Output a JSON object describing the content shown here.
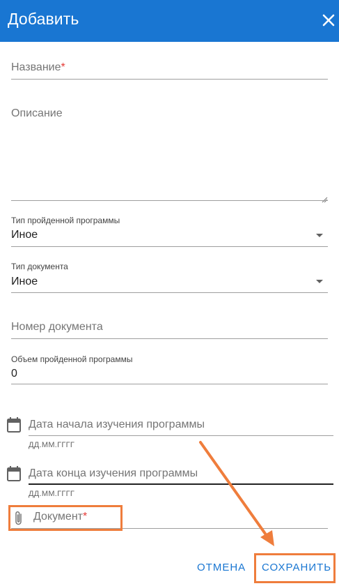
{
  "dialog": {
    "title": "Добавить",
    "close_icon": "close-icon"
  },
  "form": {
    "name_label": "Название",
    "required_mark": "*",
    "description_label": "Описание",
    "program_type": {
      "label": "Тип пройденной программы",
      "value": "Иное"
    },
    "document_type": {
      "label": "Тип документа",
      "value": "Иное"
    },
    "document_number_label": "Номер документа",
    "program_volume": {
      "label": "Объем пройденной программы",
      "value": "0"
    },
    "start_date": {
      "placeholder": "Дата начала изучения программы",
      "hint": "ДД.ММ.ГГГГ",
      "icon": "calendar-icon"
    },
    "end_date": {
      "placeholder": "Дата конца изучения программы",
      "hint": "ДД.ММ.ГГГГ",
      "icon": "calendar-icon"
    },
    "document_attach": {
      "label": "Документ",
      "icon": "paperclip-icon"
    }
  },
  "actions": {
    "cancel_label": "ОТМЕНА",
    "save_label": "СОХРАНИТЬ"
  },
  "colors": {
    "header": "#1976d2",
    "accent": "#1976d2",
    "required": "#e53935",
    "annotation": "#ef7d3c"
  }
}
